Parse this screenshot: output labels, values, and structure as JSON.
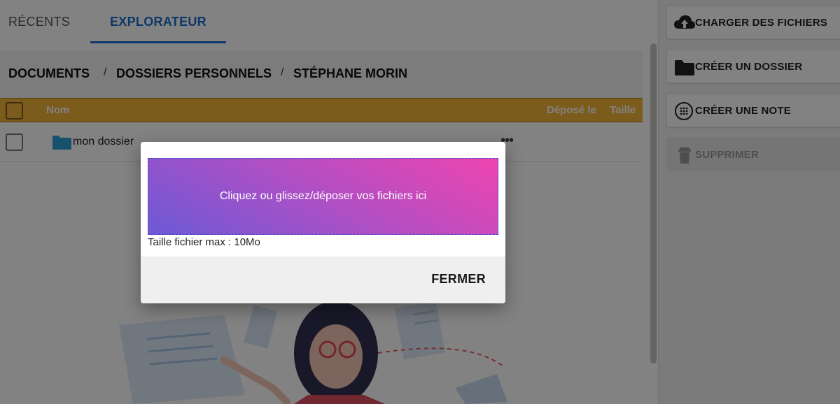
{
  "tabs": [
    {
      "label": "RÉCENTS",
      "active": false
    },
    {
      "label": "EXPLORATEUR",
      "active": true
    }
  ],
  "breadcrumb": [
    "DOCUMENTS",
    "DOSSIERS PERSONNELS",
    "STÉPHANE MORIN"
  ],
  "breadcrumb_separator": "/",
  "table": {
    "columns": {
      "name": "Nom",
      "deposited": "Déposé le",
      "size": "Taille"
    },
    "rows": [
      {
        "name": "mon dossier",
        "type": "folder",
        "more": "•••"
      }
    ]
  },
  "actions": [
    {
      "label": "CHARGER DES FICHIERS",
      "icon": "cloud-upload-icon",
      "enabled": true
    },
    {
      "label": "CRÉER UN DOSSIER",
      "icon": "folder-icon",
      "enabled": true
    },
    {
      "label": "CRÉER UNE NOTE",
      "icon": "note-dots-icon",
      "enabled": true
    },
    {
      "label": "SUPPRIMER",
      "icon": "trash-icon",
      "enabled": false
    }
  ],
  "modal": {
    "dropzone_text": "Cliquez ou glissez/déposer vos fichiers ici",
    "max_size_text": "Taille fichier max : 10Mo",
    "close_label": "FERMER"
  },
  "colors": {
    "accent": "#1a6fd0",
    "table_header": "#f3b43a",
    "folder": "#2b9fd6",
    "dropzone_start": "#6b5ad6",
    "dropzone_end": "#ee45b0"
  }
}
